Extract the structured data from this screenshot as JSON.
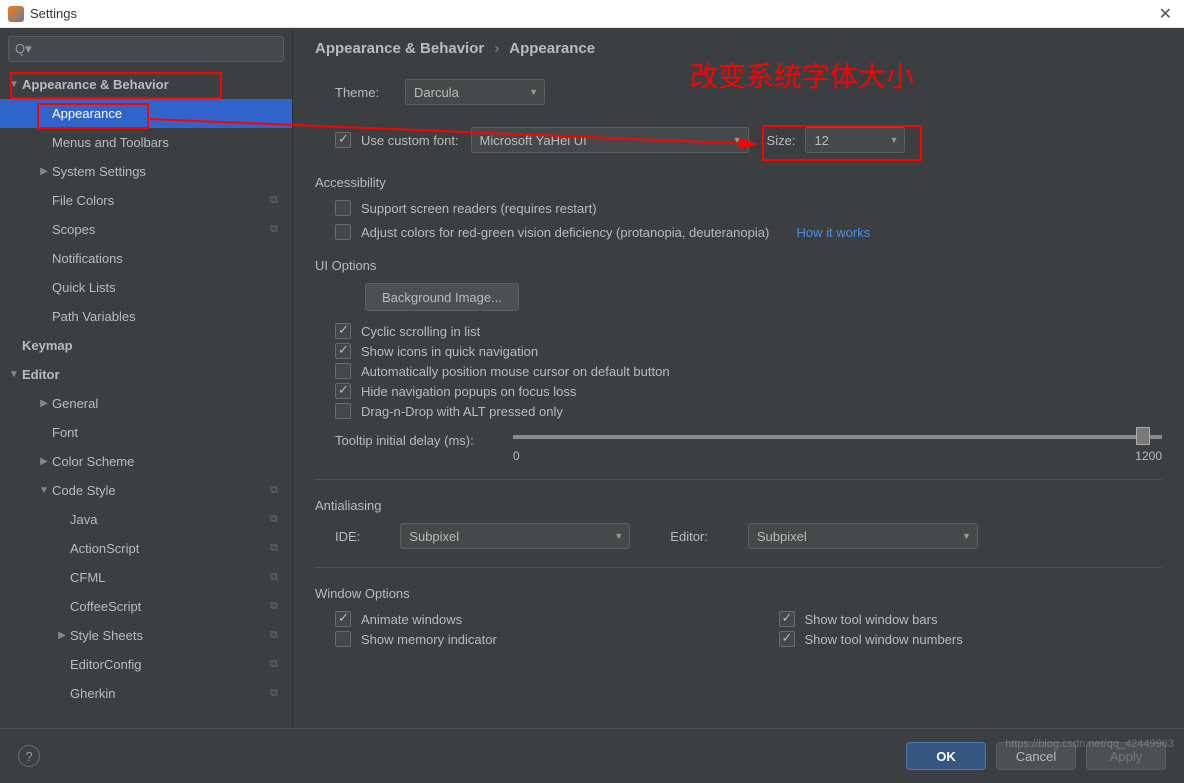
{
  "window": {
    "title": "Settings",
    "close_icon": "✕"
  },
  "search": {
    "placeholder": ""
  },
  "sidebar": {
    "items": [
      {
        "label": "Appearance & Behavior",
        "indent": 0,
        "bold": true,
        "expanded": true,
        "chevron": "▼"
      },
      {
        "label": "Appearance",
        "indent": 1,
        "selected": true
      },
      {
        "label": "Menus and Toolbars",
        "indent": 1
      },
      {
        "label": "System Settings",
        "indent": 1,
        "chevron": "▶"
      },
      {
        "label": "File Colors",
        "indent": 1,
        "copy": true
      },
      {
        "label": "Scopes",
        "indent": 1,
        "copy": true
      },
      {
        "label": "Notifications",
        "indent": 1
      },
      {
        "label": "Quick Lists",
        "indent": 1
      },
      {
        "label": "Path Variables",
        "indent": 1
      },
      {
        "label": "Keymap",
        "indent": 0,
        "bold": true
      },
      {
        "label": "Editor",
        "indent": 0,
        "bold": true,
        "expanded": true,
        "chevron": "▼"
      },
      {
        "label": "General",
        "indent": 1,
        "chevron": "▶"
      },
      {
        "label": "Font",
        "indent": 1
      },
      {
        "label": "Color Scheme",
        "indent": 1,
        "chevron": "▶"
      },
      {
        "label": "Code Style",
        "indent": 1,
        "chevron": "▼",
        "copy": true
      },
      {
        "label": "Java",
        "indent": 2,
        "copy": true
      },
      {
        "label": "ActionScript",
        "indent": 2,
        "copy": true
      },
      {
        "label": "CFML",
        "indent": 2,
        "copy": true
      },
      {
        "label": "CoffeeScript",
        "indent": 2,
        "copy": true
      },
      {
        "label": "Style Sheets",
        "indent": 2,
        "chevron": "▶",
        "copy": true
      },
      {
        "label": "EditorConfig",
        "indent": 2,
        "copy": true
      },
      {
        "label": "Gherkin",
        "indent": 2,
        "copy": true
      }
    ]
  },
  "breadcrumb": {
    "part1": "Appearance & Behavior",
    "sep": "›",
    "part2": "Appearance"
  },
  "theme": {
    "label": "Theme:",
    "value": "Darcula"
  },
  "font": {
    "check_label": "Use custom font:",
    "font_value": "Microsoft YaHei UI",
    "size_label": "Size:",
    "size_value": "12"
  },
  "accessibility": {
    "title": "Accessibility",
    "opt1": "Support screen readers (requires restart)",
    "opt2": "Adjust colors for red-green vision deficiency (protanopia, deuteranopia)",
    "link": "How it works"
  },
  "ui_options": {
    "title": "UI Options",
    "bg_btn": "Background Image...",
    "cyclic": "Cyclic scrolling in list",
    "icons": "Show icons in quick navigation",
    "auto_cursor": "Automatically position mouse cursor on default button",
    "hide_nav": "Hide navigation popups on focus loss",
    "dnd": "Drag-n-Drop with ALT pressed only",
    "tooltip_label": "Tooltip initial delay (ms):",
    "slider_min": "0",
    "slider_max": "1200"
  },
  "antialiasing": {
    "title": "Antialiasing",
    "ide_label": "IDE:",
    "ide_value": "Subpixel",
    "editor_label": "Editor:",
    "editor_value": "Subpixel"
  },
  "window_options": {
    "title": "Window Options",
    "animate": "Animate windows",
    "memory": "Show memory indicator",
    "toolbars": "Show tool window bars",
    "numbers": "Show tool window numbers"
  },
  "footer": {
    "ok": "OK",
    "cancel": "Cancel",
    "apply": "Apply"
  },
  "annotation": {
    "text": "改变系统字体大小"
  },
  "watermark": "https://blog.csdn.net/qq_42449963"
}
